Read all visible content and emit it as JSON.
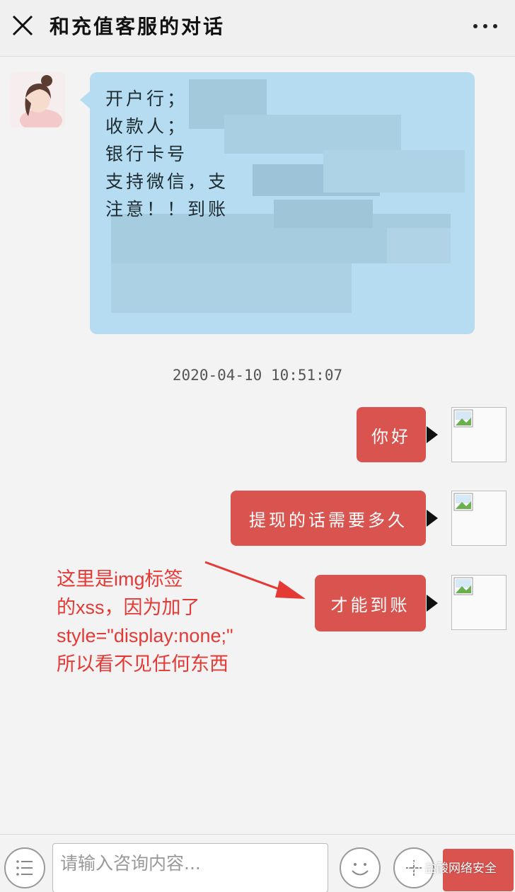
{
  "header": {
    "title": "和充值客服的对话",
    "close_icon": "close-icon",
    "more_icon": "more-icon"
  },
  "incoming_message": {
    "lines": [
      "开户行；",
      "收款人；",
      "银行卡号",
      "支持微信，支",
      "注意！！到账"
    ],
    "bubble_color": "#b5dcf0"
  },
  "timestamp": "2020-04-10 10:51:07",
  "outgoing_messages": [
    {
      "text": "你好"
    },
    {
      "text": "提现的话需要多久"
    },
    {
      "text": "才能到账"
    }
  ],
  "annotation": {
    "lines": [
      "这里是img标签",
      "的xss，因为加了",
      "style=\"display:none;\"",
      "所以看不见任何东西"
    ],
    "color": "#e53935"
  },
  "input": {
    "placeholder": "请输入咨询内容..."
  },
  "watermark": "盐酸网络安全",
  "colors": {
    "accent": "#d9534f",
    "background": "#f3f3f3"
  }
}
